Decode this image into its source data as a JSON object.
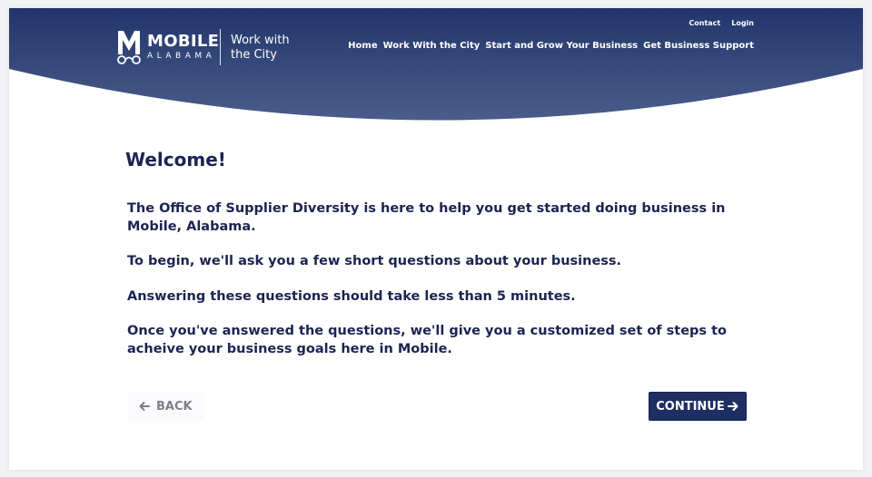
{
  "brand": {
    "logo_main": "MOBILE",
    "logo_sub": "ALABAMA",
    "section_title": "Work with the City"
  },
  "utility_nav": {
    "contact": "Contact",
    "login": "Login"
  },
  "main_nav": [
    {
      "label": "Home"
    },
    {
      "label": "Work With the City"
    },
    {
      "label": "Start and Grow Your Business"
    },
    {
      "label": "Get Business Support"
    }
  ],
  "content": {
    "heading": "Welcome!",
    "paragraphs": [
      "The Office of Supplier Diversity is here to help you get started doing business in Mobile, Alabama.",
      "To begin, we'll ask you a few short questions about your business.",
      "Answering these questions should take less than 5 minutes.",
      "Once you've answered the questions, we'll give you a customized set of steps to acheive your business goals here in Mobile."
    ]
  },
  "actions": {
    "back_label": "BACK",
    "continue_label": "CONTINUE"
  },
  "colors": {
    "header_dark": "#22356b",
    "header_light": "#4a5d8a",
    "text": "#1b2450",
    "button_primary": "#1f2f63"
  },
  "icons": {
    "back": "arrow-left-icon",
    "continue": "arrow-right-icon",
    "logo": "mobile-logo-icon"
  }
}
